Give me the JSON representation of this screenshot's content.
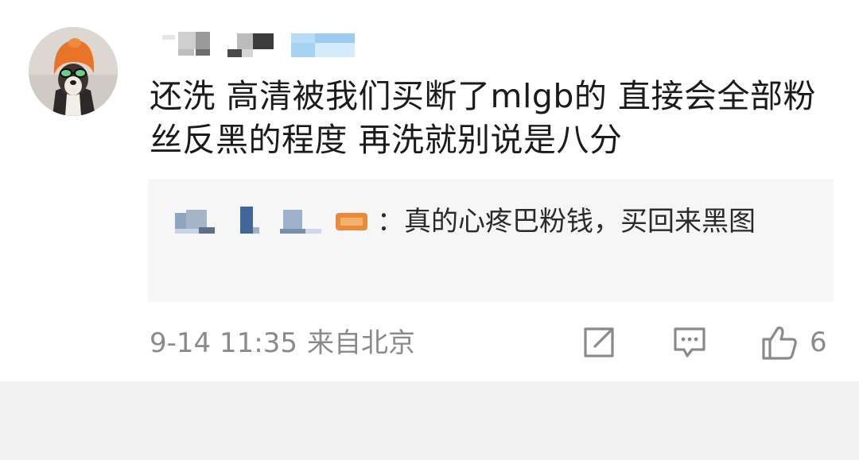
{
  "comment": {
    "text": "还洗 高清被我们买断了mlgb的 直接会全部粉丝反黑的程度 再洗就别说是八分"
  },
  "quoted_reply": {
    "text": "：真的心疼巴粉钱，买回来黑图"
  },
  "footer": {
    "time": "9-14 11:35",
    "location": "来自北京",
    "like_count": "6"
  },
  "icons": {
    "share": "share-icon",
    "reply": "comment-icon",
    "like": "thumbs-up-icon"
  },
  "colors": {
    "text": "#1b1b1b",
    "meta": "#8a8a8a",
    "reply_bg": "#f6f6f6",
    "avatar_hat": "#e8742a"
  }
}
